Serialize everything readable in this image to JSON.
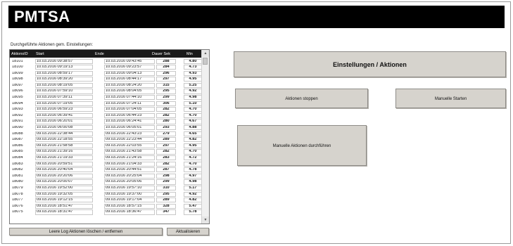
{
  "app": {
    "title": "PMTSA"
  },
  "actions_label": "Durchgeführte Aktionen gem. Einstellungen:",
  "table": {
    "columns": [
      "AktionsID",
      "Start",
      "Ende",
      "Dauer Sek",
      "Min"
    ],
    "rows": [
      [
        "18101",
        "10.03.2016 09:38:57",
        "10.03.2016 09:43:45",
        "288",
        "4.80"
      ],
      [
        "18100",
        "10.03.2016 09:19:13",
        "10.03.2016 09:23:57",
        "284",
        "4.73"
      ],
      [
        "18099",
        "10.03.2016 08:59:17",
        "10.03.2016 09:04:13",
        "296",
        "4.93"
      ],
      [
        "18098",
        "10.03.2016 08:39:20",
        "10.03.2016 08:44:17",
        "297",
        "4.95"
      ],
      [
        "18097",
        "10.03.2016 08:19:05",
        "10.03.2016 08:24:20",
        "315",
        "5.25"
      ],
      [
        "18096",
        "10.03.2016 07:59:10",
        "10.03.2016 08:04:05",
        "295",
        "4.92"
      ],
      [
        "18095",
        "10.03.2016 07:39:11",
        "10.03.2016 07:44:10",
        "299",
        "4.98"
      ],
      [
        "18094",
        "10.03.2016 07:19:05",
        "10.03.2016 07:24:11",
        "306",
        "5.10"
      ],
      [
        "18093",
        "10.03.2016 06:59:23",
        "10.03.2016 07:04:05",
        "282",
        "4.70"
      ],
      [
        "18092",
        "10.03.2016 06:39:41",
        "10.03.2016 06:44:23",
        "282",
        "4.70"
      ],
      [
        "18091",
        "10.03.2016 06:20:01",
        "10.03.2016 06:24:41",
        "280",
        "4.67"
      ],
      [
        "18090",
        "10.03.2016 06:00:08",
        "10.03.2016 06:05:01",
        "293",
        "4.88"
      ],
      [
        "18088",
        "09.03.2016 22:38:44",
        "09.03.2016 22:43:23",
        "279",
        "4.65"
      ],
      [
        "18087",
        "09.03.2016 22:18:55",
        "09.03.2016 22:23:44",
        "289",
        "4.82"
      ],
      [
        "18086",
        "09.03.2016 21:58:58",
        "09.03.2016 22:03:55",
        "297",
        "4.95"
      ],
      [
        "18085",
        "09.03.2016 21:39:16",
        "09.03.2016 21:43:58",
        "282",
        "4.70"
      ],
      [
        "18084",
        "09.03.2016 21:19:33",
        "09.03.2016 21:24:16",
        "283",
        "4.72"
      ],
      [
        "18083",
        "09.03.2016 20:59:51",
        "09.03.2016 21:04:33",
        "282",
        "4.70"
      ],
      [
        "18082",
        "09.03.2016 20:40:04",
        "09.03.2016 20:44:51",
        "287",
        "4.78"
      ],
      [
        "18081",
        "09.03.2016 20:20:06",
        "09.03.2016 20:25:04",
        "298",
        "4.97"
      ],
      [
        "18080",
        "09.03.2016 20:00:07",
        "09.03.2016 20:05:06",
        "299",
        "4.98"
      ],
      [
        "18079",
        "09.03.2016 19:52:00",
        "09.03.2016 19:57:10",
        "310",
        "5.17"
      ],
      [
        "18078",
        "09.03.2016 19:32:05",
        "09.03.2016 19:37:00",
        "295",
        "4.92"
      ],
      [
        "18077",
        "09.03.2016 19:12:15",
        "09.03.2016 19:17:04",
        "289",
        "4.82"
      ],
      [
        "18076",
        "09.03.2016 18:51:47",
        "09.03.2016 18:57:15",
        "328",
        "5.47"
      ],
      [
        "18075",
        "09.03.2016 18:31:47",
        "09.03.2016 18:36:47",
        "347",
        "5.78"
      ]
    ]
  },
  "buttons": {
    "settings": "Einstellungen / Aktionen",
    "stop": "Aktionen stoppen",
    "start": "Manuelle Starten",
    "manual": "Manuelle Aktionen durchführen",
    "clear_log": "Leere Log Aktionen löschen / entfernen",
    "refresh": "Aktualisieren"
  },
  "icons": {
    "scroll_up": "triangle-up",
    "scroll_down": "triangle-down"
  }
}
